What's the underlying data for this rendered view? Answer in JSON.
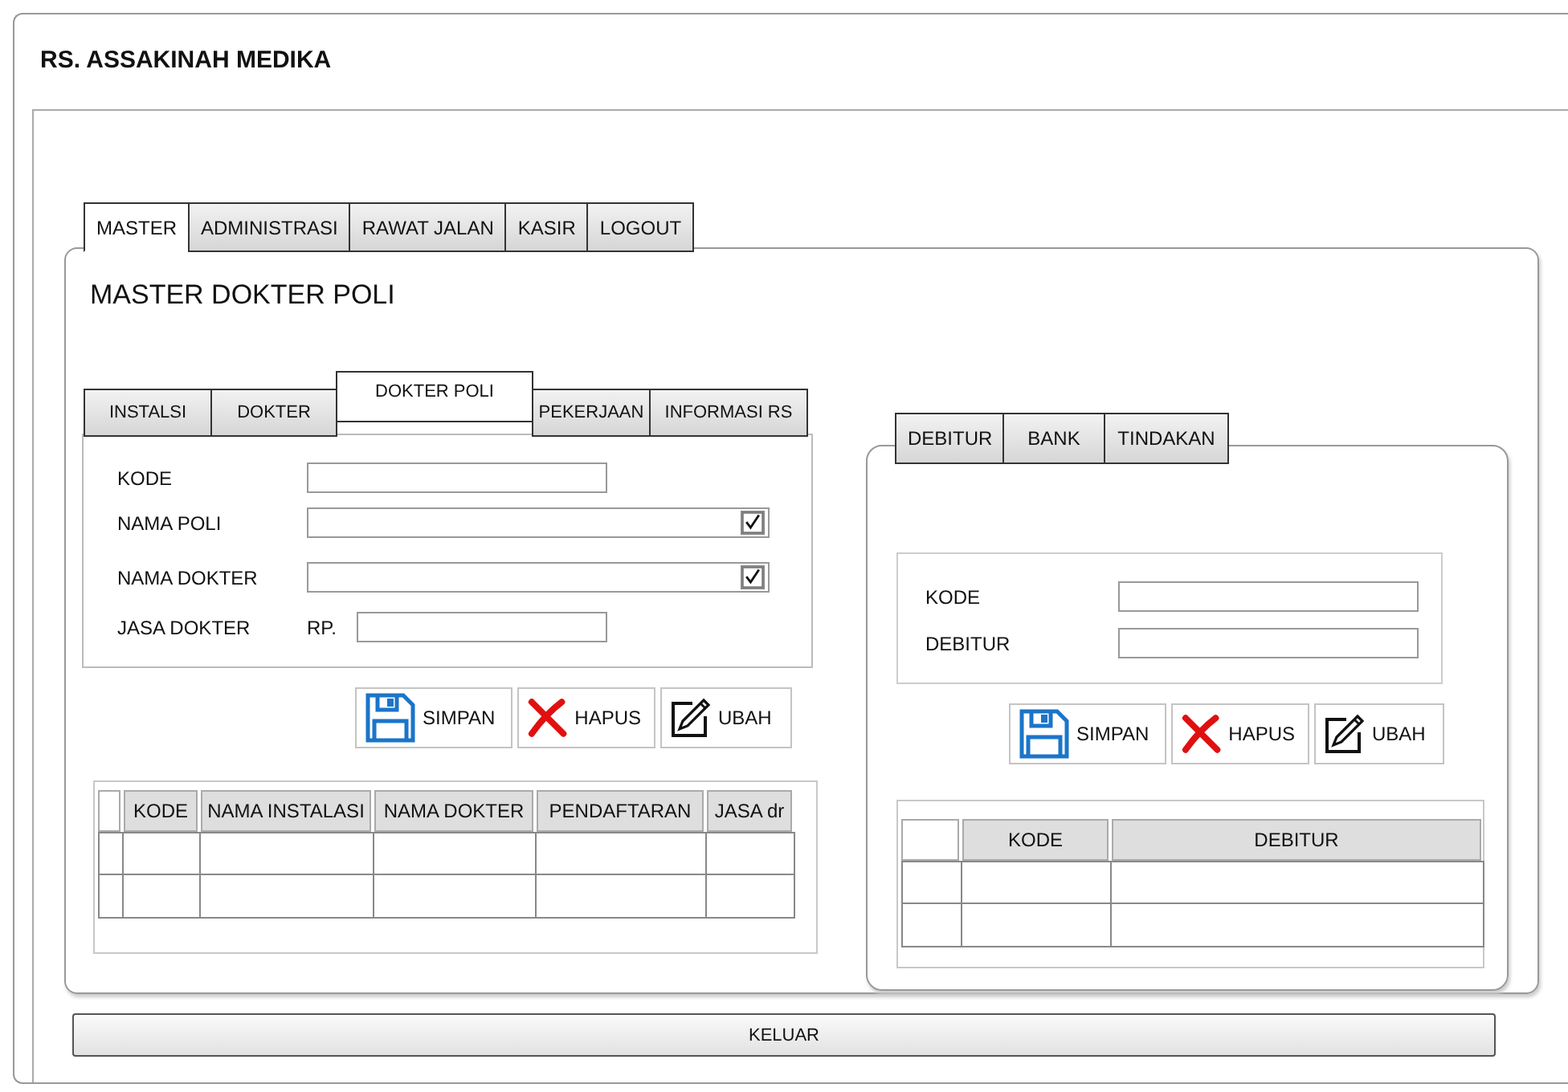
{
  "window": {
    "title": "RS. ASSAKINAH MEDIKA"
  },
  "main_tabs": [
    {
      "label": "MASTER",
      "selected": true
    },
    {
      "label": "ADMINISTRASI",
      "selected": false
    },
    {
      "label": "RAWAT JALAN",
      "selected": false
    },
    {
      "label": "KASIR",
      "selected": false
    },
    {
      "label": "LOGOUT",
      "selected": false
    }
  ],
  "page_title": "MASTER DOKTER POLI",
  "left_panel": {
    "tabs": [
      {
        "label": "INSTALSI",
        "selected": false
      },
      {
        "label": "DOKTER",
        "selected": false
      },
      {
        "label": "DOKTER POLI",
        "selected": true
      },
      {
        "label": "PEKERJAAN",
        "selected": false
      },
      {
        "label": "INFORMASI RS",
        "selected": false
      }
    ],
    "fields": [
      {
        "label": "KODE",
        "kind": "text"
      },
      {
        "label": "NAMA POLI",
        "kind": "select",
        "checked": true
      },
      {
        "label": "NAMA DOKTER",
        "kind": "select",
        "checked": true
      },
      {
        "label": "JASA DOKTER",
        "kind": "currency",
        "prefix": "RP."
      }
    ],
    "buttons": [
      {
        "label": "SIMPAN",
        "kind": "save"
      },
      {
        "label": "HAPUS",
        "kind": "delete"
      },
      {
        "label": "UBAH",
        "kind": "edit"
      }
    ],
    "table": {
      "columns": [
        "KODE",
        "NAMA INSTALASI",
        "NAMA DOKTER",
        "PENDAFTARAN",
        "JASA dr"
      ],
      "rows": [
        {
          "kind": "blank"
        },
        {
          "kind": "blank"
        }
      ]
    }
  },
  "right_panel": {
    "tabs": [
      {
        "label": "DEBITUR",
        "selected": false
      },
      {
        "label": "BANK",
        "selected": false
      },
      {
        "label": "TINDAKAN",
        "selected": false
      }
    ],
    "fields": [
      {
        "label": "KODE",
        "kind": "text"
      },
      {
        "label": "DEBITUR",
        "kind": "text"
      }
    ],
    "buttons": [
      {
        "label": "SIMPAN",
        "kind": "save"
      },
      {
        "label": "HAPUS",
        "kind": "delete"
      },
      {
        "label": "UBAH",
        "kind": "edit"
      }
    ],
    "table": {
      "columns": [
        "KODE",
        "DEBITUR"
      ],
      "rows": [
        {
          "kind": "blank"
        },
        {
          "kind": "blank"
        }
      ]
    }
  },
  "footer_button": "KELUAR"
}
